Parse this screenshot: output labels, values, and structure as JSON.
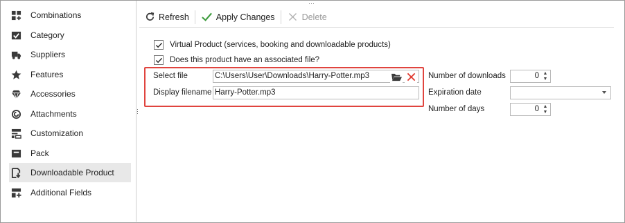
{
  "sidebar": {
    "items": [
      {
        "label": "Combinations",
        "icon": "grid-plus-icon"
      },
      {
        "label": "Category",
        "icon": "category-check-icon"
      },
      {
        "label": "Suppliers",
        "icon": "truck-icon"
      },
      {
        "label": "Features",
        "icon": "star-icon"
      },
      {
        "label": "Accessories",
        "icon": "diamond-icon"
      },
      {
        "label": "Attachments",
        "icon": "paperclip-icon"
      },
      {
        "label": "Customization",
        "icon": "customization-icon"
      },
      {
        "label": "Pack",
        "icon": "pack-icon"
      },
      {
        "label": "Downloadable Product",
        "icon": "download-file-icon",
        "active": true
      },
      {
        "label": "Additional Fields",
        "icon": "fields-plus-icon"
      }
    ]
  },
  "toolbar": {
    "refresh_label": "Refresh",
    "apply_label": "Apply Changes",
    "delete_label": "Delete"
  },
  "form": {
    "virtual_product_label": "Virtual Product (services, booking and downloadable products)",
    "virtual_product_checked": true,
    "associated_file_label": "Does this product have an associated file?",
    "associated_file_checked": true,
    "select_file_label": "Select file",
    "select_file_value": "C:\\Users\\User\\Downloads\\Harry-Potter.mp3",
    "display_filename_label": "Display filename",
    "display_filename_value": "Harry-Potter.mp3",
    "number_of_downloads_label": "Number of downloads",
    "number_of_downloads_value": "0",
    "expiration_date_label": "Expiration date",
    "expiration_date_value": "",
    "number_of_days_label": "Number of days",
    "number_of_days_value": "0"
  },
  "colors": {
    "highlight": "#e0443e",
    "apply_check": "#3a9a3a",
    "delete_x": "#e03a2f",
    "icon_dark": "#3a3a3a"
  }
}
